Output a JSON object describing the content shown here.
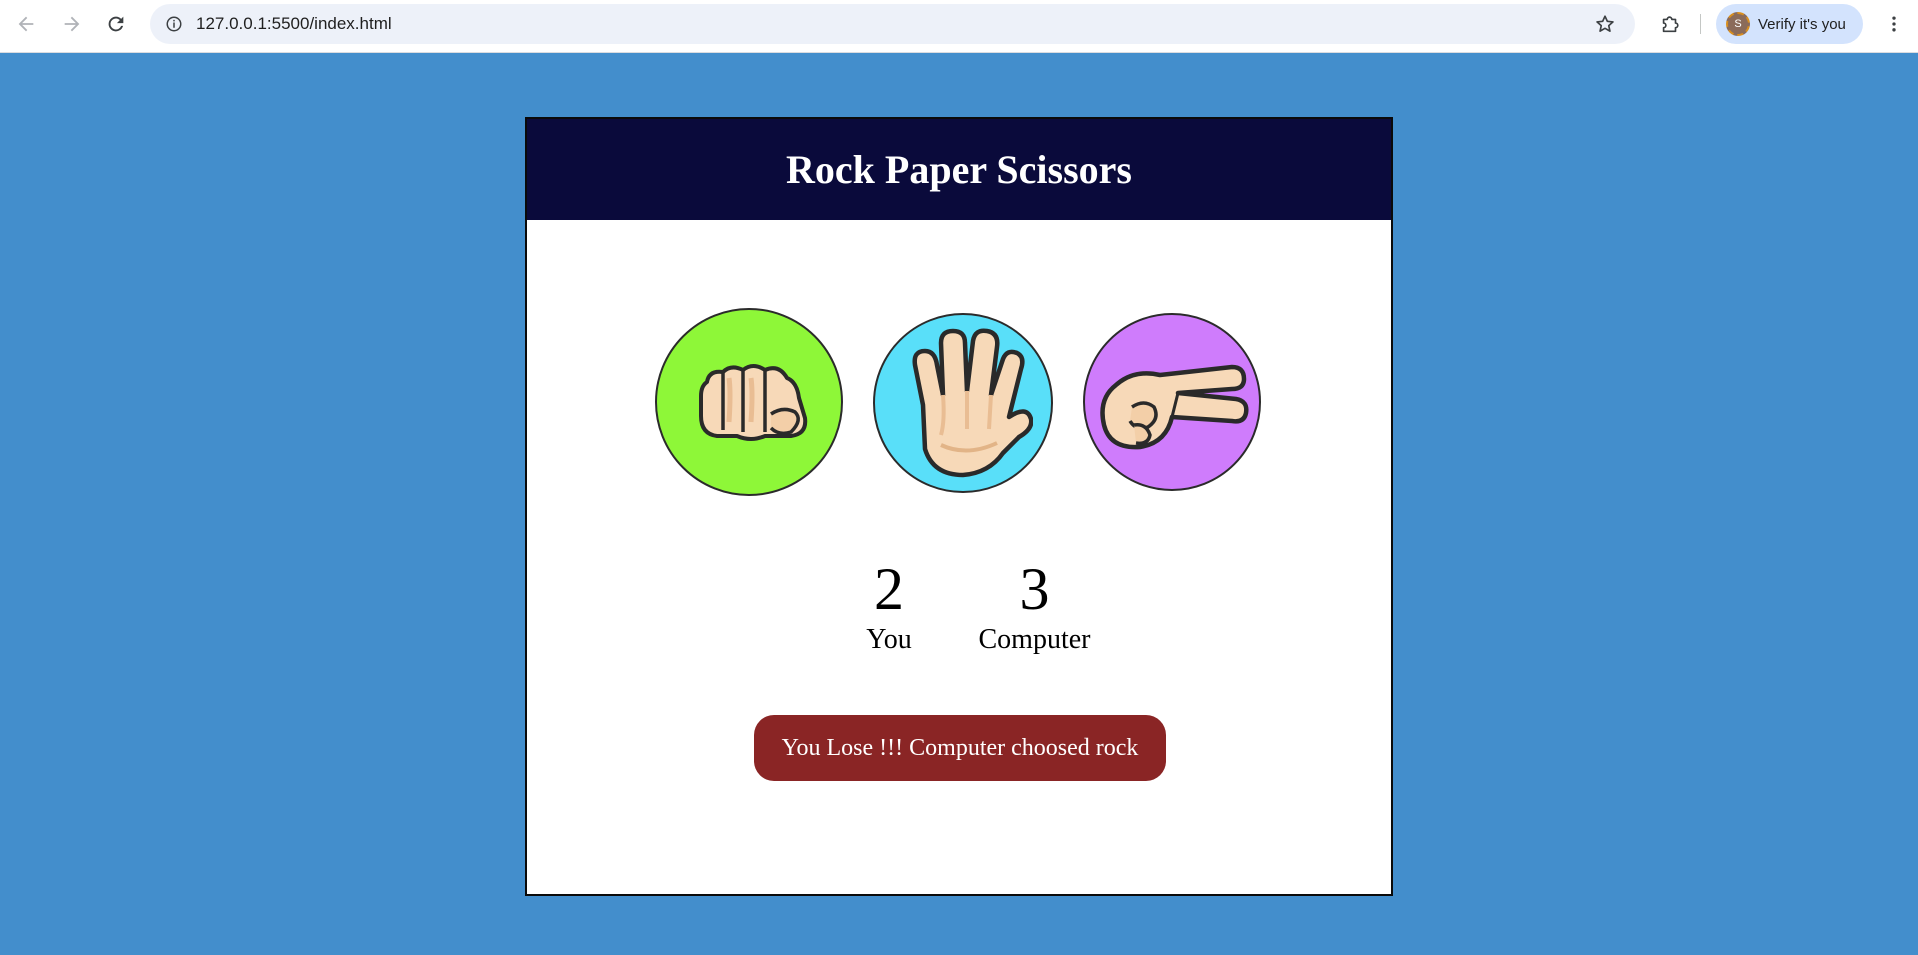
{
  "browser": {
    "url": "127.0.0.1:5500/index.html",
    "profile_label": "Verify it's you",
    "profile_initial": "S"
  },
  "game": {
    "title": "Rock Paper Scissors",
    "choices": [
      {
        "name": "rock",
        "color": "#8ef738"
      },
      {
        "name": "paper",
        "color": "#59dff9"
      },
      {
        "name": "scissors",
        "color": "#cf7cfc"
      }
    ],
    "score": {
      "user_score": "2",
      "user_label": "You",
      "computer_score": "3",
      "computer_label": "Computer"
    },
    "message": "You Lose !!! Computer choosed rock",
    "message_color": "#8a2525"
  }
}
